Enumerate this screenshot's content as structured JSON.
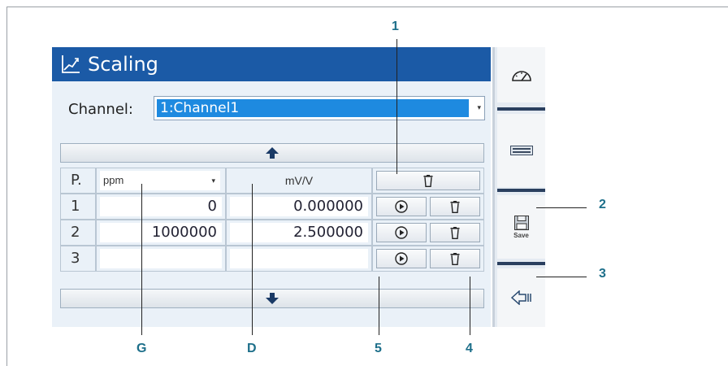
{
  "panel": {
    "title": "Scaling",
    "channel_label": "Channel:",
    "channel_value": "1:Channel1"
  },
  "table": {
    "header": {
      "p": "P.",
      "unit": "ppm",
      "mv_label": "mV/V"
    },
    "rows": [
      {
        "p": "1",
        "value": "0",
        "mv": "0.000000"
      },
      {
        "p": "2",
        "value": "1000000",
        "mv": "2.500000"
      },
      {
        "p": "3",
        "value": "",
        "mv": ""
      }
    ]
  },
  "sidebar": {
    "save_label": "Save"
  },
  "callouts": {
    "c1": "1",
    "c2": "2",
    "c3": "3",
    "c4": "4",
    "c5": "5",
    "cG": "G",
    "cD": "D"
  },
  "colors": {
    "title_bar": "#1b5aa6",
    "selection": "#1e8ae0",
    "callout": "#1d6f8a"
  }
}
